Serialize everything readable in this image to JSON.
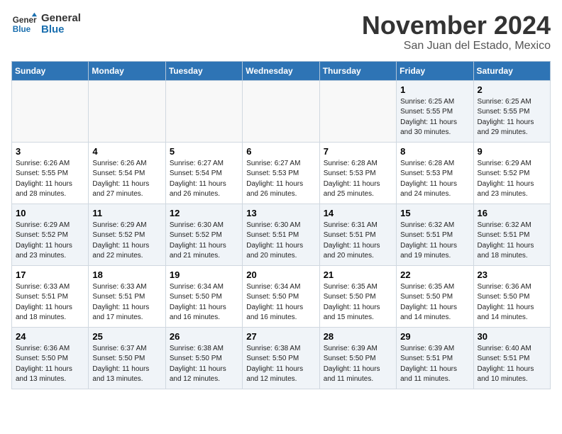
{
  "header": {
    "logo_general": "General",
    "logo_blue": "Blue",
    "month": "November 2024",
    "location": "San Juan del Estado, Mexico"
  },
  "weekdays": [
    "Sunday",
    "Monday",
    "Tuesday",
    "Wednesday",
    "Thursday",
    "Friday",
    "Saturday"
  ],
  "weeks": [
    [
      {
        "day": "",
        "info": ""
      },
      {
        "day": "",
        "info": ""
      },
      {
        "day": "",
        "info": ""
      },
      {
        "day": "",
        "info": ""
      },
      {
        "day": "",
        "info": ""
      },
      {
        "day": "1",
        "info": "Sunrise: 6:25 AM\nSunset: 5:55 PM\nDaylight: 11 hours\nand 30 minutes."
      },
      {
        "day": "2",
        "info": "Sunrise: 6:25 AM\nSunset: 5:55 PM\nDaylight: 11 hours\nand 29 minutes."
      }
    ],
    [
      {
        "day": "3",
        "info": "Sunrise: 6:26 AM\nSunset: 5:55 PM\nDaylight: 11 hours\nand 28 minutes."
      },
      {
        "day": "4",
        "info": "Sunrise: 6:26 AM\nSunset: 5:54 PM\nDaylight: 11 hours\nand 27 minutes."
      },
      {
        "day": "5",
        "info": "Sunrise: 6:27 AM\nSunset: 5:54 PM\nDaylight: 11 hours\nand 26 minutes."
      },
      {
        "day": "6",
        "info": "Sunrise: 6:27 AM\nSunset: 5:53 PM\nDaylight: 11 hours\nand 26 minutes."
      },
      {
        "day": "7",
        "info": "Sunrise: 6:28 AM\nSunset: 5:53 PM\nDaylight: 11 hours\nand 25 minutes."
      },
      {
        "day": "8",
        "info": "Sunrise: 6:28 AM\nSunset: 5:53 PM\nDaylight: 11 hours\nand 24 minutes."
      },
      {
        "day": "9",
        "info": "Sunrise: 6:29 AM\nSunset: 5:52 PM\nDaylight: 11 hours\nand 23 minutes."
      }
    ],
    [
      {
        "day": "10",
        "info": "Sunrise: 6:29 AM\nSunset: 5:52 PM\nDaylight: 11 hours\nand 23 minutes."
      },
      {
        "day": "11",
        "info": "Sunrise: 6:29 AM\nSunset: 5:52 PM\nDaylight: 11 hours\nand 22 minutes."
      },
      {
        "day": "12",
        "info": "Sunrise: 6:30 AM\nSunset: 5:52 PM\nDaylight: 11 hours\nand 21 minutes."
      },
      {
        "day": "13",
        "info": "Sunrise: 6:30 AM\nSunset: 5:51 PM\nDaylight: 11 hours\nand 20 minutes."
      },
      {
        "day": "14",
        "info": "Sunrise: 6:31 AM\nSunset: 5:51 PM\nDaylight: 11 hours\nand 20 minutes."
      },
      {
        "day": "15",
        "info": "Sunrise: 6:32 AM\nSunset: 5:51 PM\nDaylight: 11 hours\nand 19 minutes."
      },
      {
        "day": "16",
        "info": "Sunrise: 6:32 AM\nSunset: 5:51 PM\nDaylight: 11 hours\nand 18 minutes."
      }
    ],
    [
      {
        "day": "17",
        "info": "Sunrise: 6:33 AM\nSunset: 5:51 PM\nDaylight: 11 hours\nand 18 minutes."
      },
      {
        "day": "18",
        "info": "Sunrise: 6:33 AM\nSunset: 5:51 PM\nDaylight: 11 hours\nand 17 minutes."
      },
      {
        "day": "19",
        "info": "Sunrise: 6:34 AM\nSunset: 5:50 PM\nDaylight: 11 hours\nand 16 minutes."
      },
      {
        "day": "20",
        "info": "Sunrise: 6:34 AM\nSunset: 5:50 PM\nDaylight: 11 hours\nand 16 minutes."
      },
      {
        "day": "21",
        "info": "Sunrise: 6:35 AM\nSunset: 5:50 PM\nDaylight: 11 hours\nand 15 minutes."
      },
      {
        "day": "22",
        "info": "Sunrise: 6:35 AM\nSunset: 5:50 PM\nDaylight: 11 hours\nand 14 minutes."
      },
      {
        "day": "23",
        "info": "Sunrise: 6:36 AM\nSunset: 5:50 PM\nDaylight: 11 hours\nand 14 minutes."
      }
    ],
    [
      {
        "day": "24",
        "info": "Sunrise: 6:36 AM\nSunset: 5:50 PM\nDaylight: 11 hours\nand 13 minutes."
      },
      {
        "day": "25",
        "info": "Sunrise: 6:37 AM\nSunset: 5:50 PM\nDaylight: 11 hours\nand 13 minutes."
      },
      {
        "day": "26",
        "info": "Sunrise: 6:38 AM\nSunset: 5:50 PM\nDaylight: 11 hours\nand 12 minutes."
      },
      {
        "day": "27",
        "info": "Sunrise: 6:38 AM\nSunset: 5:50 PM\nDaylight: 11 hours\nand 12 minutes."
      },
      {
        "day": "28",
        "info": "Sunrise: 6:39 AM\nSunset: 5:50 PM\nDaylight: 11 hours\nand 11 minutes."
      },
      {
        "day": "29",
        "info": "Sunrise: 6:39 AM\nSunset: 5:51 PM\nDaylight: 11 hours\nand 11 minutes."
      },
      {
        "day": "30",
        "info": "Sunrise: 6:40 AM\nSunset: 5:51 PM\nDaylight: 11 hours\nand 10 minutes."
      }
    ]
  ]
}
